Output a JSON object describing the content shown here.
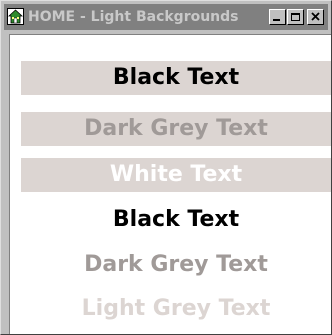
{
  "window": {
    "title": "HOME - Light Backgrounds",
    "app_icon": "green-house-icon",
    "controls": [
      "minimize-icon",
      "maximize-icon",
      "close-icon"
    ]
  },
  "rows": [
    {
      "text": "Black Text",
      "color": "#000000",
      "background": "#dcd5d2"
    },
    {
      "text": "Dark Grey Text",
      "color": "#a09a98",
      "background": "#dcd5d2"
    },
    {
      "text": "White Text",
      "color": "#ffffff",
      "background": "#dcd5d2"
    },
    {
      "text": "Black Text",
      "color": "#000000",
      "background": "#ffffff"
    },
    {
      "text": "Dark Grey Text",
      "color": "#a09a98",
      "background": "#ffffff"
    },
    {
      "text": "Light Grey Text",
      "color": "#dcd5d2",
      "background": "#ffffff"
    }
  ],
  "colors": {
    "titlebar_inactive": "#808080",
    "title_text": "#c8c8c8",
    "window_face": "#c0c0c0"
  }
}
